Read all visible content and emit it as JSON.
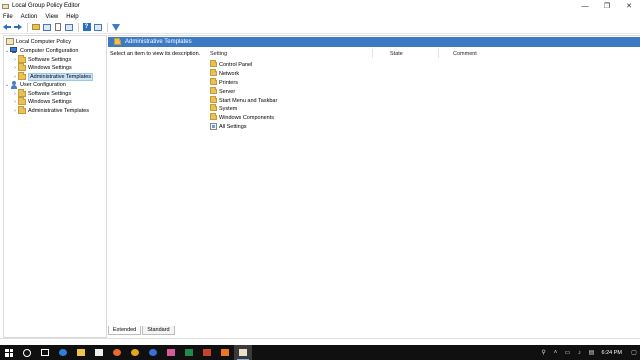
{
  "window": {
    "title": "Local Group Policy Editor",
    "minimize": "—",
    "maximize": "❐",
    "close": "✕"
  },
  "menu": [
    "File",
    "Action",
    "View",
    "Help"
  ],
  "tree": {
    "root": "Local Computer Policy",
    "computer": "Computer Configuration",
    "computer_children": [
      "Software Settings",
      "Windows Settings",
      "Administrative Templates"
    ],
    "user": "User Configuration",
    "user_children": [
      "Software Settings",
      "Windows Settings",
      "Administrative Templates"
    ]
  },
  "main": {
    "header": "Administrative Templates",
    "description": "Select an item to view its description.",
    "columns": [
      "Setting",
      "State",
      "Comment"
    ],
    "items": [
      "Control Panel",
      "Network",
      "Printers",
      "Server",
      "Start Menu and Taskbar",
      "System",
      "Windows Components",
      "All Settings"
    ]
  },
  "tabs": [
    "Extended",
    "Standard"
  ],
  "taskbar": {
    "time": "6:24 PM",
    "icons": [
      "windows-start",
      "cortana",
      "task-view",
      "edge",
      "file-explorer",
      "store",
      "firefox",
      "chrome",
      "mail",
      "media",
      "excel",
      "powerpoint",
      "sublime",
      "gpedit"
    ]
  },
  "colors": {
    "header_bar": "#3d79c4",
    "selection": "#cce4f7",
    "taskbar": "#101010"
  }
}
